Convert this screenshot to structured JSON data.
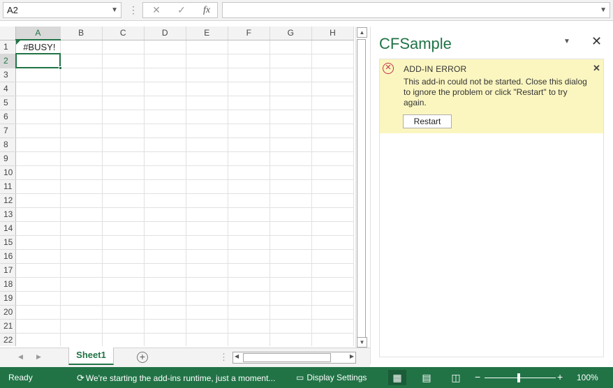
{
  "formula_bar": {
    "name_box": "A2",
    "cancel_icon": "close-icon",
    "enter_icon": "checkmark-icon",
    "fx_label": "fx",
    "formula_value": ""
  },
  "grid": {
    "columns": [
      "A",
      "B",
      "C",
      "D",
      "E",
      "F",
      "G",
      "H"
    ],
    "rows": [
      "1",
      "2",
      "3",
      "4",
      "5",
      "6",
      "7",
      "8",
      "9",
      "10",
      "11",
      "12",
      "13",
      "14",
      "15",
      "16",
      "17",
      "18",
      "19",
      "20",
      "21",
      "22"
    ],
    "cells": {
      "A1": "#BUSY!"
    },
    "selected_cell": "A2"
  },
  "task_pane": {
    "title": "CFSample",
    "error": {
      "title": "ADD-IN ERROR",
      "message": "This add-in could not be started. Close this dialog to ignore the problem or click \"Restart\" to try again.",
      "restart_label": "Restart"
    }
  },
  "sheets": {
    "tabs": [
      "Sheet1"
    ],
    "active": "Sheet1"
  },
  "status_bar": {
    "ready": "Ready",
    "runtime_message": "We're starting the add-ins runtime, just a moment...",
    "display_settings": "Display Settings",
    "zoom": "100%",
    "zoom_minus": "−",
    "zoom_plus": "+"
  },
  "colors": {
    "accent": "#217346",
    "error_background": "#fbf6c0",
    "error_icon": "#c4314b"
  }
}
